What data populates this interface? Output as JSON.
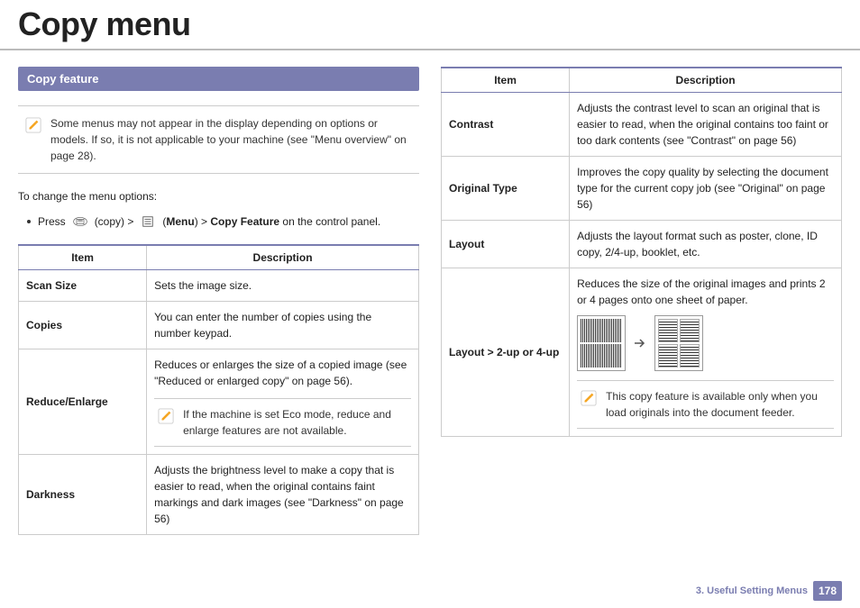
{
  "title": "Copy menu",
  "section_header": "Copy feature",
  "top_note": "Some menus may not appear in the display depending on options or models. If so, it is not applicable to your machine (see \"Menu overview\" on page 28).",
  "intro": "To change the menu options:",
  "instruction": {
    "prefix": "Press",
    "copy_label": "(copy) >",
    "menu_bold": "Menu",
    "middle": ") > ",
    "feature_bold": "Copy Feature",
    "suffix": " on the control panel."
  },
  "table_header": {
    "item": "Item",
    "desc": "Description"
  },
  "left_rows": [
    {
      "item": "Scan Size",
      "desc": "Sets the image size."
    },
    {
      "item": "Copies",
      "desc": "You can enter the number of copies using the number keypad."
    },
    {
      "item": "Reduce/Enlarge",
      "desc": "Reduces or enlarges the size of a copied image (see \"Reduced or enlarged copy\" on page 56).",
      "note": "If the machine is set Eco mode, reduce and enlarge features are not available."
    },
    {
      "item": "Darkness",
      "desc": "Adjusts the brightness level to make a copy that is easier to read, when the original contains faint markings and dark images (see \"Darkness\" on page 56)"
    }
  ],
  "right_rows": [
    {
      "item": "Contrast",
      "desc": "Adjusts the contrast level to scan an original that is easier to read, when the original contains too faint or too dark contents (see \"Contrast\" on page 56)"
    },
    {
      "item": "Original Type",
      "desc": "Improves the copy quality by selecting the document type for the current copy job (see \"Original\" on page 56)"
    },
    {
      "item": "Layout",
      "desc": "Adjusts the layout format such as poster, clone, ID copy, 2/4-up, booklet, etc."
    },
    {
      "item": "Layout > 2-up or 4-up",
      "desc": "Reduces the size of the original images and prints 2 or 4 pages onto one sheet of paper.",
      "note": "This copy feature is available only when you load originals into the document feeder."
    }
  ],
  "footer": {
    "chapter": "3.  Useful Setting Menus",
    "page": "178"
  }
}
